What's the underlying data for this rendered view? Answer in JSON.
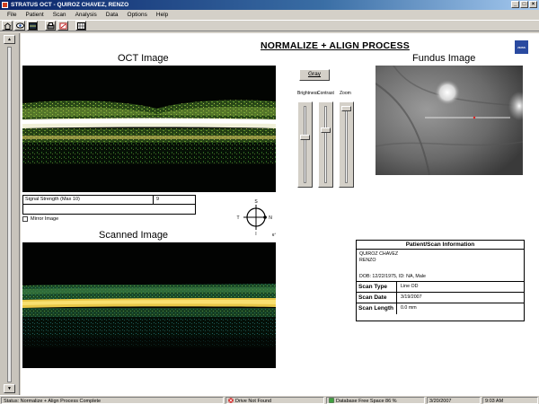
{
  "window": {
    "title": "STRATUS OCT - QUIROZ CHAVEZ, RENZO"
  },
  "menu": [
    "File",
    "Patient",
    "Scan",
    "Analysis",
    "Data",
    "Options",
    "Help"
  ],
  "toolbar": {
    "icons": [
      "home-icon",
      "eye-icon",
      "scan-icon",
      "print-icon",
      "export-icon",
      "grid-icon"
    ]
  },
  "page": {
    "title": "NORMALIZE + ALIGN PROCESS",
    "brand": "ZEISS"
  },
  "oct": {
    "title": "OCT Image"
  },
  "fundus": {
    "title": "Fundus Image"
  },
  "scanned": {
    "title": "Scanned Image"
  },
  "signal": {
    "label": "Signal Strength (Max 10)",
    "value": "9"
  },
  "mirror": {
    "label": "Mirror Image",
    "checked": false
  },
  "orientation": {
    "top": "S",
    "left": "T",
    "right": "N",
    "bottom": "I",
    "corner": "6°"
  },
  "controls": {
    "gray_label": "Gray",
    "sliders": [
      {
        "label": "Brightness",
        "level": 0.4
      },
      {
        "label": "Contrast",
        "level": 0.3
      },
      {
        "label": "Zoom",
        "level": 0.0
      }
    ]
  },
  "patient_info": {
    "header": "Patient/Scan Information",
    "last_name": "QUIROZ CHAVEZ",
    "first_name": "RENZO",
    "dob_line": "DOB: 12/22/1975, ID: NA, Male",
    "rows": [
      {
        "label": "Scan Type",
        "value": "Line  OD"
      },
      {
        "label": "Scan Date",
        "value": "3/19/2007"
      },
      {
        "label": "Scan Length",
        "value": "0.0 mm"
      }
    ]
  },
  "status": {
    "message": "Status: Normalize + Align Process Complete",
    "drive": "Drive Not Found",
    "db_space": "Database Free Space 86 %",
    "date": "3/20/2007",
    "time": "9:03 AM"
  },
  "colors": {
    "title_bar": "#0a246a",
    "retina_green": "#6aa030",
    "retina_yellow": "#e8d870",
    "cross_red": "#e02020"
  }
}
